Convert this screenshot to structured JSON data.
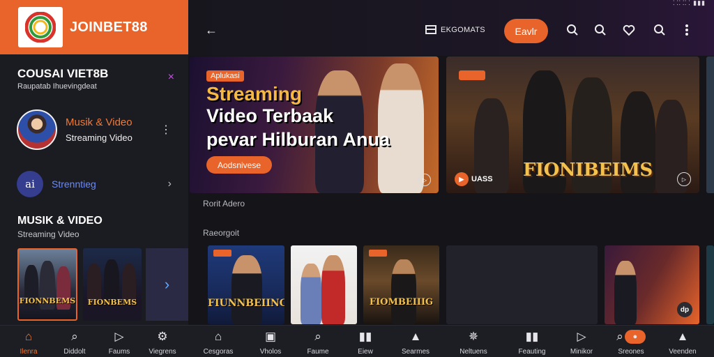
{
  "status_bar": {
    "text": "⸬⸬⸬ ▮▮▮"
  },
  "sidebar": {
    "brand": "JOINBET88",
    "section_title": "COUSAI VIET8B",
    "section_subtitle": "Raupatab Ihuevingdeat",
    "close_glyph": "×",
    "featured": {
      "title": "Musik & Video",
      "subtitle": "Streaming Video",
      "menu_glyph": "⋮"
    },
    "row": {
      "icon_text": "ai",
      "label": "Strenntieg",
      "chevron": "›"
    },
    "heading2": "MUSIK & VIDEO",
    "heading2_sub": "Streaming Video",
    "thumbs": [
      {
        "caption": "FIONNBEMS"
      },
      {
        "caption": "FIONBEMS"
      }
    ],
    "next_glyph": "›"
  },
  "topbar": {
    "back_glyph": "←",
    "menu_label": "EKGOMATS",
    "button_label": "Eavlr",
    "icons": [
      "search-icon",
      "search-icon",
      "heart-icon",
      "search-icon",
      "more-icon"
    ]
  },
  "hero": [
    {
      "tag": "Aplukasi",
      "title_line1": "Streaming",
      "title_line2": "Video Terbaak",
      "title_line3": "pevar Hilburan Anua",
      "cta": "Aodsnivese",
      "play_glyph": "▷"
    },
    {
      "title": "FIONIBEIMS",
      "badge": "UASS",
      "play_glyph": "▷",
      "badge_glyph": "▶"
    }
  ],
  "sections": {
    "label1": "Rorit Adero",
    "label2": "Raeorgoit"
  },
  "cards": [
    {
      "caption": "FIUNNBEIING"
    },
    {
      "caption": ""
    },
    {
      "caption": "FIOMBEIIIG"
    },
    {
      "caption": ""
    },
    {
      "caption": "",
      "badge": "dp"
    }
  ],
  "bottom_nav": [
    {
      "label": "Ilenra",
      "icon": "home-icon",
      "glyph": "⌂"
    },
    {
      "label": "Diddolt",
      "icon": "search-icon",
      "glyph": "⌕"
    },
    {
      "label": "Faums",
      "icon": "play-icon",
      "glyph": "▷"
    },
    {
      "label": "Viegrens",
      "icon": "gear-icon",
      "glyph": "⚙"
    },
    {
      "label": "Cesgoras",
      "icon": "home-icon",
      "glyph": "⌂"
    },
    {
      "label": "Vholos",
      "icon": "cube-icon",
      "glyph": "▣"
    },
    {
      "label": "Faume",
      "icon": "search-icon",
      "glyph": "⌕"
    },
    {
      "label": "Eiew",
      "icon": "bookmark-icon",
      "glyph": "▮▮"
    },
    {
      "label": "Searmes",
      "icon": "user-icon",
      "glyph": "▲"
    },
    {
      "label": "Neltuens",
      "icon": "star-icon",
      "glyph": "✵"
    },
    {
      "label": "Feauting",
      "icon": "library-icon",
      "glyph": "▮▮"
    },
    {
      "label": "Minikor",
      "icon": "play-icon",
      "glyph": "▷"
    },
    {
      "label": "Sreones",
      "icon": "search-icon",
      "glyph": "⌕",
      "pill": "●"
    },
    {
      "label": "Veenden",
      "icon": "user-icon",
      "glyph": "▲"
    }
  ],
  "colors": {
    "accent": "#e8642a",
    "link": "#6d8bf2",
    "gold": "#f2c14e"
  }
}
